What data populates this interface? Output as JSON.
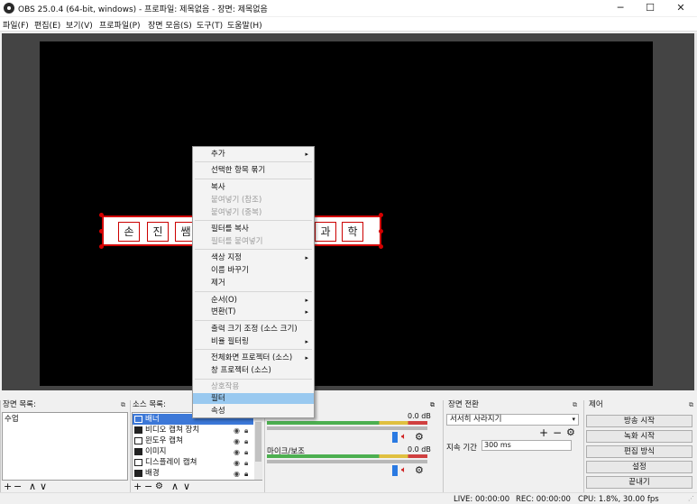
{
  "window": {
    "title": "OBS 25.0.4 (64-bit, windows) - 프로파일: 제목없음 - 장면: 제목없음",
    "minimize": "─",
    "maximize": "☐",
    "close": "✕"
  },
  "menubar": {
    "items": [
      "파일(F)",
      "편집(E)",
      "보기(V)",
      "프로파일(P)",
      "장면 모음(S)",
      "도구(T)",
      "도움말(H)"
    ]
  },
  "banner": {
    "glyphs": [
      "손",
      "진",
      "쌤",
      "과",
      "학"
    ]
  },
  "context_menu": {
    "items": [
      {
        "label": "추가",
        "submenu": true
      },
      {
        "label": "선택한 항목 묶기"
      },
      {
        "label": "복사"
      },
      {
        "label": "붙여넣기 (참조)",
        "disabled": true
      },
      {
        "label": "붙여넣기 (중복)",
        "disabled": true
      },
      {
        "label": "필터를 복사"
      },
      {
        "label": "필터를 붙여넣기",
        "disabled": true
      },
      {
        "label": "색상 지정",
        "submenu": true
      },
      {
        "label": "이름 바꾸기"
      },
      {
        "label": "제거"
      },
      {
        "label": "순서(O)",
        "submenu": true
      },
      {
        "label": "변환(T)",
        "submenu": true
      },
      {
        "label": "출력 크기 조정 (소스 크기)"
      },
      {
        "label": "비율 필터링",
        "submenu": true
      },
      {
        "label": "전체화면 프로젝터 (소스)",
        "submenu": true
      },
      {
        "label": "창 프로젝터 (소스)"
      },
      {
        "label": "상호작용",
        "disabled": true
      },
      {
        "label": "필터",
        "highlighted": true
      },
      {
        "label": "속성"
      }
    ],
    "submenu_arrow": "▸"
  },
  "scenes_dock": {
    "title": "장면 목록:",
    "items": [
      "수업"
    ],
    "toolbar": [
      "+",
      "−",
      "∧",
      "∨"
    ]
  },
  "sources_dock": {
    "title": "소스 목록:",
    "items": [
      {
        "name": "배너",
        "icon": "image-icon",
        "selected": true
      },
      {
        "name": "비디오 캡쳐 장치",
        "icon": "camera-icon"
      },
      {
        "name": "윈도우 캡쳐",
        "icon": "window-icon"
      },
      {
        "name": "이미지",
        "icon": "image-icon"
      },
      {
        "name": "디스플레이 캡쳐",
        "icon": "monitor-icon"
      },
      {
        "name": "배경",
        "icon": "image-icon"
      }
    ],
    "toolbar": [
      "+",
      "−",
      "⚙",
      "∧",
      "∨"
    ]
  },
  "mixer": {
    "channels": [
      {
        "name": "",
        "level": "0.0 dB"
      },
      {
        "name": "마이크/보조",
        "level": "0.0 dB"
      }
    ]
  },
  "transitions_dock": {
    "title": "장면 전환",
    "selected": "서서히 사라지기",
    "duration_label": "지속 기간",
    "duration_value": "300 ms"
  },
  "controls_dock": {
    "title": "제어",
    "buttons": [
      "방송 시작",
      "녹화 시작",
      "편집 방식",
      "설정",
      "끝내기"
    ]
  },
  "statusbar": {
    "live": "LIVE: 00:00:00",
    "rec": "REC: 00:00:00",
    "cpu": "CPU: 1.8%, 30.00 fps"
  },
  "colors": {
    "selection": "#3c78d8",
    "menu_highlight": "#99c9f0",
    "banner_border": "#d40000"
  }
}
